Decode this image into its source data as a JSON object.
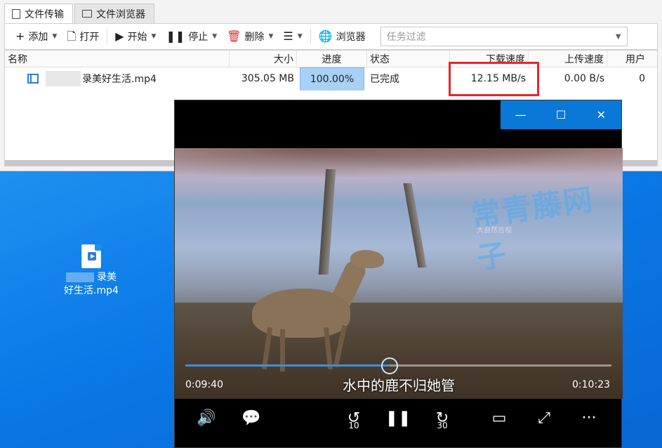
{
  "app": {
    "tabs": [
      {
        "label": "文件传输",
        "active": true
      },
      {
        "label": "文件浏览器",
        "active": false
      }
    ],
    "toolbar": {
      "add": "添加",
      "open": "打开",
      "start": "开始",
      "stop": "停止",
      "delete": "删除",
      "browser": "浏览器",
      "filter_placeholder": "任务过滤"
    },
    "columns": {
      "name": "名称",
      "size": "大小",
      "progress": "进度",
      "status": "状态",
      "download_speed": "下载速度",
      "upload_speed": "上传速度",
      "users": "用户"
    },
    "rows": [
      {
        "name": "录美好生活.mp4",
        "size": "305.05 MB",
        "progress_text": "100.00%",
        "progress_fraction": 1.0,
        "status": "已完成",
        "download_speed": "12.15 MB/s",
        "upload_speed": "0.00 B/s",
        "users": "0"
      }
    ]
  },
  "desktop": {
    "icon_label_line1": "录美",
    "icon_label_line2": "好生活.mp4"
  },
  "player": {
    "watermark": "常青藤网子",
    "watermark_small": "大自然吉视",
    "subtitle": "水中的鹿不归她管",
    "time_current": "0:09:40",
    "time_total": "0:10:23",
    "progress_fraction": 0.48,
    "rewind_label": "10",
    "forward_label": "30"
  },
  "colors": {
    "accent": "#0a78d7",
    "highlight_box": "#e8242a",
    "progress_fill": "#a9d1f5",
    "desktop": "#0a78e6"
  }
}
